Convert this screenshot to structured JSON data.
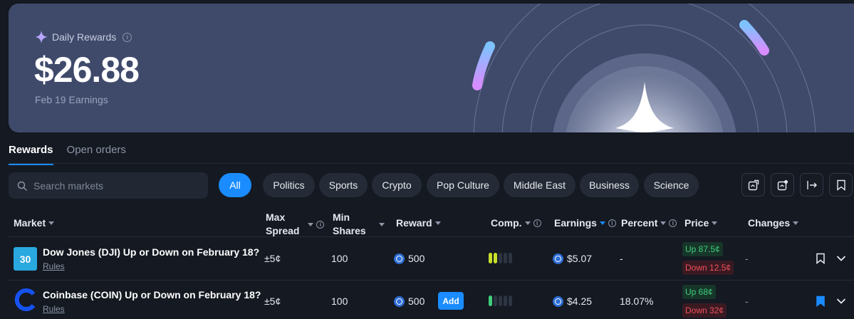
{
  "hero": {
    "label": "Daily Rewards",
    "amount": "$26.88",
    "subtitle": "Feb 19 Earnings"
  },
  "tabs": [
    {
      "label": "Rewards",
      "active": true
    },
    {
      "label": "Open orders",
      "active": false
    }
  ],
  "search": {
    "placeholder": "Search markets"
  },
  "chips": [
    {
      "label": "All",
      "active": true
    },
    {
      "label": "Politics"
    },
    {
      "label": "Sports"
    },
    {
      "label": "Crypto"
    },
    {
      "label": "Pop Culture"
    },
    {
      "label": "Middle East"
    },
    {
      "label": "Business"
    },
    {
      "label": "Science"
    }
  ],
  "toolbar_icons": [
    "share-icon",
    "calendar-share-icon",
    "sign-in-icon",
    "bookmark-icon"
  ],
  "columns": {
    "market": "Market",
    "max_spread": [
      "Max",
      "Spread"
    ],
    "min_shares": [
      "Min",
      "Shares"
    ],
    "reward": "Reward",
    "comp": "Comp.",
    "earnings": "Earnings",
    "percent": "Percent",
    "price": "Price",
    "changes": "Changes"
  },
  "rows": [
    {
      "title": "Dow Jones (DJI) Up or Down on February 18?",
      "rules": "Rules",
      "icon_label": "30",
      "icon_color": "#2aa8e0",
      "max_spread": "±5¢",
      "min_shares": "100",
      "reward": "500",
      "comp_levels": 5,
      "comp_filled": 2,
      "comp_color": "#c8e02a",
      "earnings": "$5.07",
      "percent": "-",
      "price_up": "Up 87.5¢",
      "price_down": "Down 12.5¢",
      "changes": "-",
      "bookmarked": false
    },
    {
      "title": "Coinbase (COIN) Up or Down on February 18?",
      "rules": "Rules",
      "icon_label": "C",
      "icon_color": "#1652f0",
      "max_spread": "±5¢",
      "min_shares": "100",
      "reward": "500",
      "add_label": "Add",
      "comp_levels": 5,
      "comp_filled": 1,
      "comp_color": "#3fcf7a",
      "earnings": "$4.25",
      "percent": "18.07%",
      "price_up": "Up 68¢",
      "price_down": "Down 32¢",
      "changes": "-",
      "bookmarked": true
    }
  ],
  "colors": {
    "accent": "#1a8cff",
    "hero_bg": "#3f4a6b",
    "page_bg": "#141922",
    "up": "#3fcf7a",
    "down": "#f0505a"
  }
}
